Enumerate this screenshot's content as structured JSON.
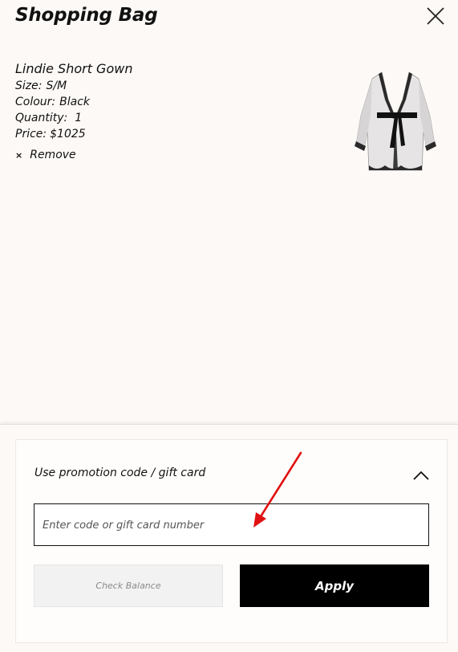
{
  "header": {
    "title": "Shopping Bag"
  },
  "item": {
    "name": "Lindie Short Gown",
    "size_label": "Size:",
    "size_value": "S/M",
    "colour_label": "Colour:",
    "colour_value": "Black",
    "quantity_label": "Quantity:",
    "quantity_value": "1",
    "price_label": "Price:",
    "price_value": "$1025",
    "remove_symbol": "×",
    "remove_label": "Remove",
    "image_icon": "black-lace-sheer-short-gown"
  },
  "promo": {
    "label": "Use promotion code / gift card",
    "placeholder": "Enter code or gift card number",
    "value": "",
    "check_balance_label": "Check Balance",
    "apply_label": "Apply",
    "expanded": true
  },
  "annotation": {
    "arrow_color": "#e01010"
  },
  "colors": {
    "background": "#fdf9f6",
    "text": "#111111",
    "apply_bg": "#000000",
    "check_balance_bg": "#f2f2f2"
  }
}
